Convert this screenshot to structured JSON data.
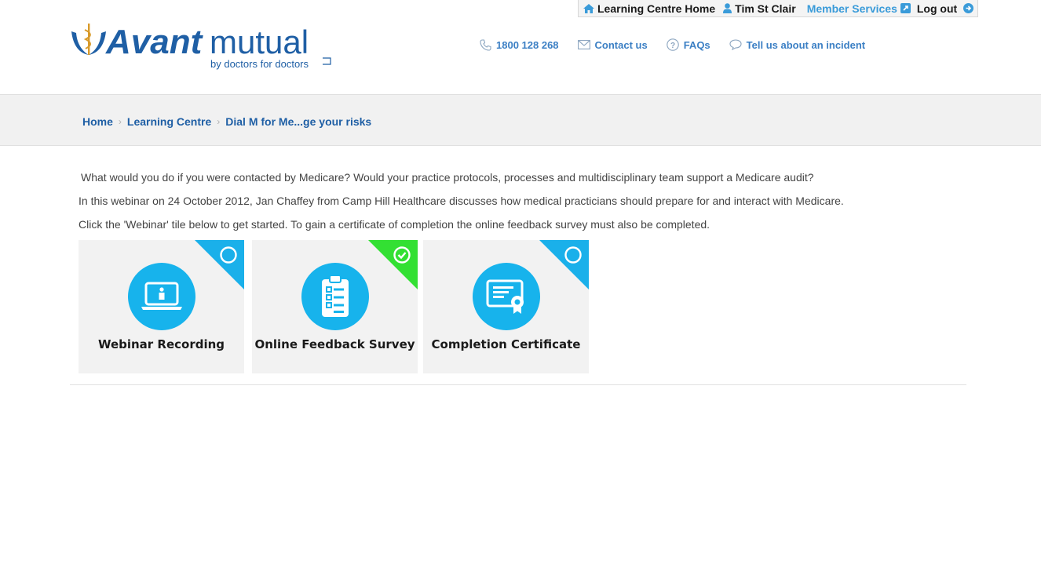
{
  "userbar": {
    "home_label": "Learning Centre Home",
    "user_name": "Tim St Clair",
    "member_services": "Member Services",
    "logout": "Log out"
  },
  "logo": {
    "brand_bold": "Avant",
    "brand_light": "mutual",
    "tagline": "by doctors for doctors"
  },
  "topnav": {
    "phone": "1800 128 268",
    "contact": "Contact us",
    "faqs": "FAQs",
    "incident": "Tell us about an incident"
  },
  "breadcrumb": [
    "Home",
    "Learning Centre",
    "Dial M for Me...ge your risks"
  ],
  "intro": [
    "What would you do if you were contacted by Medicare? Would your practice protocols, processes and multidisciplinary team support a Medicare audit?",
    "In this webinar on 24 October 2012, Jan Chaffey from Camp Hill Healthcare discusses how medical practicians should prepare for and interact with Medicare.",
    "Click the 'Webinar' tile below to get started. To gain a certificate of completion the online feedback survey must also be completed."
  ],
  "tiles": [
    {
      "label": "Webinar Recording",
      "icon": "laptop-icon",
      "status": "incomplete",
      "corner_color": "#1ab0ea"
    },
    {
      "label": "Online Feedback Survey",
      "icon": "clipboard-icon",
      "status": "complete",
      "corner_color": "#33e033"
    },
    {
      "label": "Completion Certificate",
      "icon": "certificate-icon",
      "status": "incomplete",
      "corner_color": "#1ab0ea"
    }
  ],
  "colors": {
    "accent_blue": "#17b3ec",
    "link_blue": "#1f5fa5",
    "complete_green": "#33e033"
  }
}
